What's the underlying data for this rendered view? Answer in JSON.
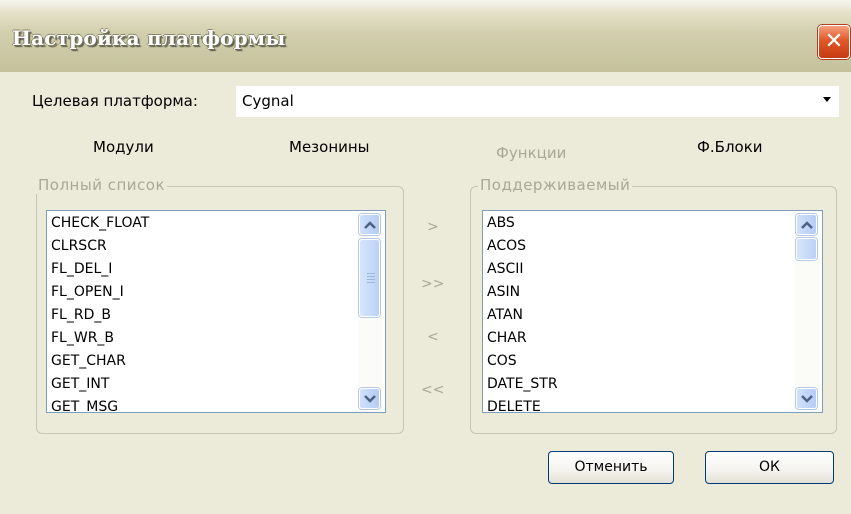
{
  "window": {
    "title": "Настройка платформы",
    "close_glyph": "✕"
  },
  "target": {
    "label": "Целевая платформа:",
    "value": "Cygnal"
  },
  "tabs": [
    {
      "label": "Модули",
      "disabled": false
    },
    {
      "label": "Мезонины",
      "disabled": false
    },
    {
      "label": "Функции",
      "disabled": true
    },
    {
      "label": "Ф.Блоки",
      "disabled": false
    }
  ],
  "full_list": {
    "legend": "Полный список",
    "items": [
      "CHECK_FLOAT",
      "CLRSCR",
      "FL_DEL_I",
      "FL_OPEN_I",
      "FL_RD_B",
      "FL_WR_B",
      "GET_CHAR",
      "GET_INT",
      "GET_MSG"
    ]
  },
  "supported_list": {
    "legend": "Поддерживаемый",
    "items": [
      "ABS",
      "ACOS",
      "ASCII",
      "ASIN",
      "ATAN",
      "CHAR",
      "COS",
      "DATE_STR",
      "DELETE"
    ]
  },
  "movers": {
    "add": ">",
    "add_all": ">>",
    "remove": "<",
    "remove_all": "<<"
  },
  "buttons": {
    "cancel": "Отменить",
    "ok": "ОК"
  },
  "colors": {
    "dialog_bg": "#ecead8",
    "disabled_text": "#a8a896",
    "close_red": "#e1582a",
    "scroll_blue": "#c3d6f8"
  }
}
